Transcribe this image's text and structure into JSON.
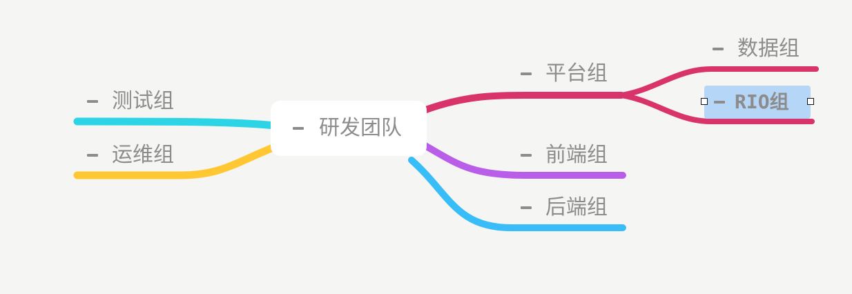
{
  "colors": {
    "background": "#f5f6f3",
    "text": "#8c8c8c",
    "branch_test": "#2dd4e6",
    "branch_ops": "#ffc833",
    "branch_platform": "#d9336b",
    "branch_frontend": "#b95ee8",
    "branch_backend": "#38bdf8",
    "selection": "#b6d6f8"
  },
  "mindmap": {
    "root": {
      "label": "研发团队",
      "collapse_icon": "minus-icon"
    },
    "left_branches": [
      {
        "label": "测试组",
        "collapse_icon": "minus-icon"
      },
      {
        "label": "运维组",
        "collapse_icon": "minus-icon"
      }
    ],
    "right_branches": [
      {
        "label": "平台组",
        "collapse_icon": "minus-icon",
        "children": [
          {
            "label": "数据组",
            "collapse_icon": "minus-icon"
          },
          {
            "label": "RIO组",
            "collapse_icon": "minus-icon",
            "selected": true
          }
        ]
      },
      {
        "label": "前端组",
        "collapse_icon": "minus-icon"
      },
      {
        "label": "后端组",
        "collapse_icon": "minus-icon"
      }
    ]
  }
}
